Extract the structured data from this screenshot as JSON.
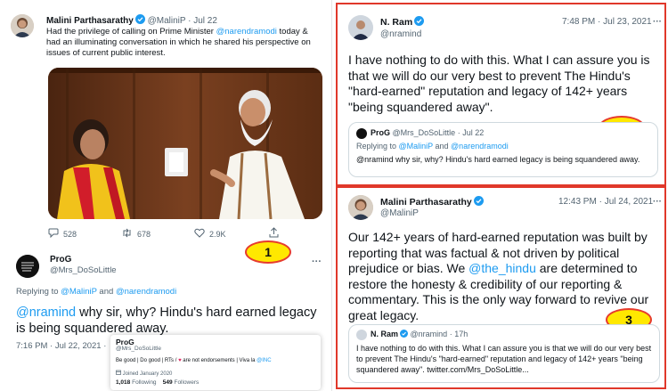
{
  "colors": {
    "link": "#1d9bf0",
    "gray": "#536471",
    "highlight_box": "#e0382a",
    "badge_fill": "#ffe800"
  },
  "panel1": {
    "author": {
      "name": "Malini Parthasarathy",
      "handle": "@MaliniP",
      "date": "· Jul 22"
    },
    "text_before": "Had the privilege of calling on Prime Minister ",
    "text_mention": "@narendramodi",
    "text_after": " today & had an illuminating conversation in which he shared his perspective on issues of current public interest.",
    "stats": {
      "replies": "528",
      "retweets": "678",
      "likes": "2.9K"
    },
    "badge": "1",
    "reply": {
      "name": "ProG",
      "handle": "@Mrs_DoSoLittle",
      "more": "···",
      "replying_prefix": "Replying to ",
      "replying_user1": "@MaliniP",
      "replying_and": " and ",
      "replying_user2": "@narendramodi",
      "mention": "@nramind",
      "text": " why sir, why? Hindu's hard earned legacy is being squandered away.",
      "timestamp": "7:16 PM · Jul 22, 2021 ·"
    },
    "hovercard": {
      "name": "ProG",
      "handle": "@Mrs_DoSoLittle",
      "bio_before": "Be good | Do good | RTs / ",
      "bio_heart": "♥",
      "bio_middle": " are not endorsements | Viva la ",
      "bio_mention": "@INC",
      "joined": "Joined January 2020",
      "following_count": "1,018",
      "following_label": "Following",
      "followers_count": "549",
      "followers_label": "Followers"
    }
  },
  "panel2": {
    "author": {
      "name": "N. Ram",
      "handle": "@nramind"
    },
    "time": "7:48 PM · Jul 23, 2021",
    "more": "···",
    "text": "I have nothing to do with this. What I can assure you is that we will do our very best to prevent The Hindu's \"hard-earned\" reputation and legacy of 142+ years \"being squandered away\".",
    "badge": "2",
    "quote": {
      "name": "ProG",
      "handle": "@Mrs_DoSoLittle",
      "date": "· Jul 22",
      "replying_prefix": "Replying to ",
      "replying_user1": "@MaliniP",
      "replying_and": " and ",
      "replying_user2": "@narendramodi",
      "text": "@nramind why sir, why? Hindu's hard earned legacy is being squandered away."
    }
  },
  "panel3": {
    "author": {
      "name": "Malini Parthasarathy",
      "handle": "@MaliniP"
    },
    "time": "12:43 PM · Jul 24, 2021",
    "more": "···",
    "text_before": "Our 142+ years of hard-earned reputation was built by reporting that was factual & not driven by political prejudice or bias. We ",
    "text_mention": "@the_hindu",
    "text_after": " are determined to restore the honesty & credibility of our reporting & commentary. This is the only way forward to revive our great legacy.",
    "badge": "3",
    "quote": {
      "name": "N. Ram",
      "handle": "@nramind",
      "date": "· 17h",
      "text": "I have nothing to do with this. What I can assure you is that we will do our very best to prevent The Hindu's \"hard-earned\" reputation and legacy of 142+ years \"being squandered away\". twitter.com/Mrs_DoSoLittle..."
    }
  }
}
